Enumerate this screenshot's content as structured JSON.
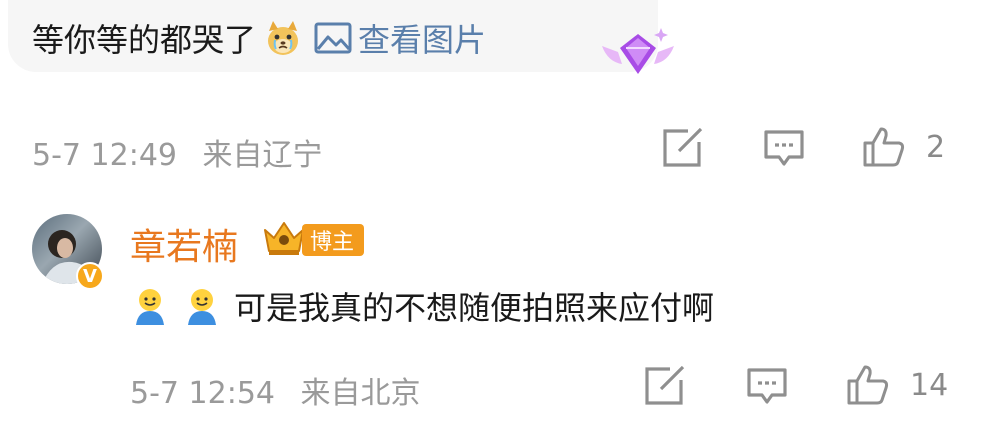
{
  "comment1": {
    "text": "等你等的都哭了",
    "emoji_icon": "crying-dog-emoji",
    "view_image_label": "查看图片",
    "badge_icon": "purple-gem-wing-badge",
    "date": "5-7 12:49",
    "location": "来自辽宁",
    "like_count": "2"
  },
  "comment2": {
    "username": "章若楠",
    "role_tag": "博主",
    "verified_mark": "V",
    "emoji_icons": [
      "smiling-person-emoji",
      "smiling-person-emoji"
    ],
    "text": "可是我真的不想随便拍照来应付啊",
    "date": "5-7 12:54",
    "location": "来自北京",
    "like_count": "14"
  },
  "colors": {
    "username": "#e8781f",
    "role_tag_bg": "#f39b1d",
    "link": "#5a7fab",
    "meta_text": "#9a9a9a",
    "bubble_bg": "#f6f6f6"
  }
}
